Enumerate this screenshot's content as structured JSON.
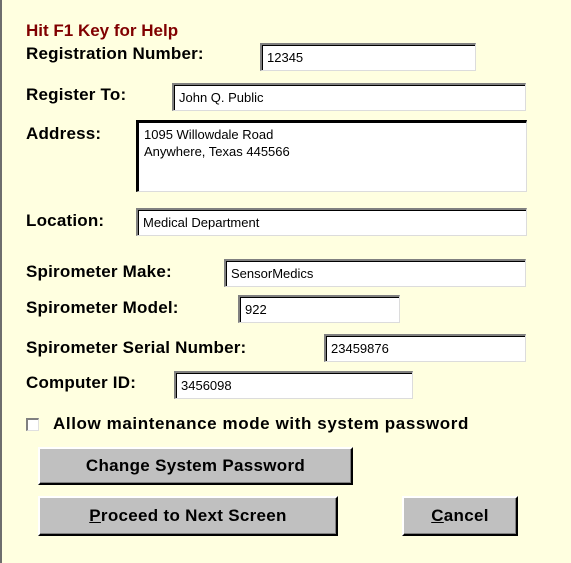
{
  "help_text": "Hit F1 Key for Help",
  "fields": {
    "registration_number": {
      "label": "Registration Number:",
      "value": "12345"
    },
    "register_to": {
      "label": "Register To:",
      "value": "John Q. Public"
    },
    "address": {
      "label": "Address:",
      "value": "1095 Willowdale Road\nAnywhere, Texas  445566"
    },
    "location": {
      "label": "Location:",
      "value": "Medical Department"
    },
    "spirometer_make": {
      "label": "Spirometer Make:",
      "value": "SensorMedics"
    },
    "spirometer_model": {
      "label": "Spirometer Model:",
      "value": "922"
    },
    "spirometer_serial": {
      "label": "Spirometer Serial Number:",
      "value": "23459876"
    },
    "computer_id": {
      "label": "Computer ID:",
      "value": "3456098"
    }
  },
  "maintenance_checkbox": {
    "label": "Allow maintenance mode with system password",
    "checked": false
  },
  "buttons": {
    "change_password": "Change System Password",
    "proceed": {
      "mnemonic": "P",
      "rest": "roceed to Next Screen"
    },
    "cancel": {
      "mnemonic": "C",
      "rest": "ancel"
    }
  },
  "colors": {
    "background": "#ffffe0",
    "help_text": "#800000",
    "button_face": "#c0c0c0"
  }
}
